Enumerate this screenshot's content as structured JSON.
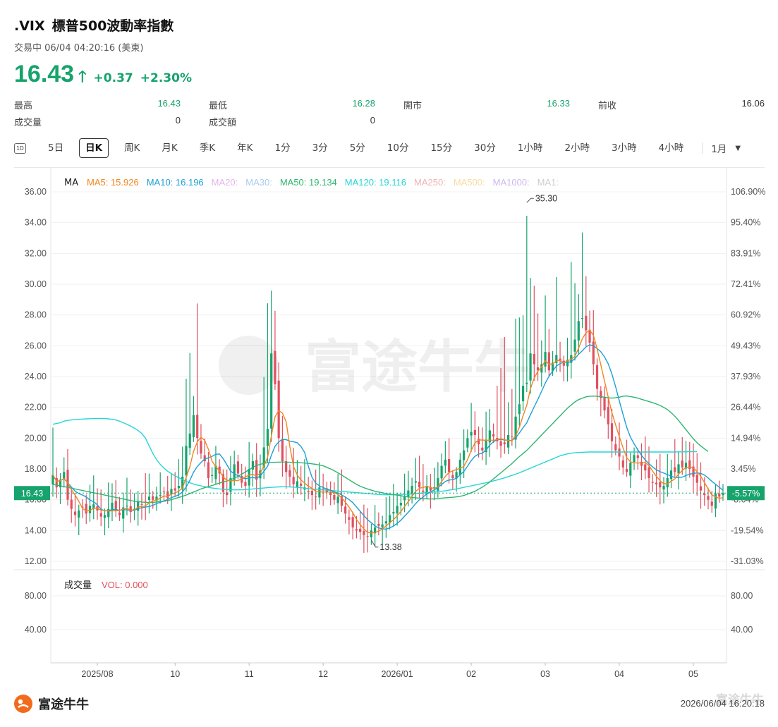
{
  "header": {
    "symbol": ".VIX",
    "name": "標普500波動率指數",
    "status": "交易中 06/04 04:20:16 (美東)",
    "price": "16.43",
    "change": "+0.37",
    "change_pct": "+2.30%"
  },
  "stats": {
    "high_label": "最高",
    "high": "16.43",
    "low_label": "最低",
    "low": "16.28",
    "open_label": "開市",
    "open": "16.33",
    "prev_label": "前收",
    "prev": "16.06",
    "volume_label": "成交量",
    "volume": "0",
    "turnover_label": "成交額",
    "turnover": "0"
  },
  "tabs": {
    "icon_label": "1D",
    "items": [
      "5日",
      "日K",
      "周K",
      "月K",
      "季K",
      "年K",
      "1分",
      "3分",
      "5分",
      "10分",
      "15分",
      "30分",
      "1小時",
      "2小時",
      "3小時",
      "4小時"
    ],
    "active": "日K",
    "dropdown_label": "1月"
  },
  "chart_data": {
    "type": "candlestick",
    "title": ".VIX 標普500波動率指數",
    "ma_label": "MA",
    "ma_legend": [
      {
        "label": "MA5: 15.926",
        "color": "#f0861f"
      },
      {
        "label": "MA10: 16.196",
        "color": "#1b9fd8"
      },
      {
        "label": "MA20:",
        "color": "#e6b3e8"
      },
      {
        "label": "MA30:",
        "color": "#a8ccec"
      },
      {
        "label": "MA50: 19.134",
        "color": "#2db56f"
      },
      {
        "label": "MA120: 19.116",
        "color": "#25d6d6"
      },
      {
        "label": "MA250:",
        "color": "#f2b3b3"
      },
      {
        "label": "MA500:",
        "color": "#f7dca0"
      },
      {
        "label": "MA1000:",
        "color": "#cdb8ee"
      },
      {
        "label": "MA1:",
        "color": "#cccccc"
      }
    ],
    "ylim": [
      12,
      36
    ],
    "y_ticks": [
      "36.00",
      "34.00",
      "32.00",
      "30.00",
      "28.00",
      "26.00",
      "24.00",
      "22.00",
      "20.00",
      "18.00",
      "16.00",
      "14.00",
      "12.00"
    ],
    "y_right_ticks": [
      "106.90%",
      "95.40%",
      "83.91%",
      "72.41%",
      "60.92%",
      "49.43%",
      "37.93%",
      "26.44%",
      "14.94%",
      "3.45%",
      "-8.04%",
      "-19.54%",
      "-31.03%"
    ],
    "x_labels": [
      {
        "label": "2025/08",
        "i": 12
      },
      {
        "label": "10",
        "i": 33
      },
      {
        "label": "11",
        "i": 53
      },
      {
        "label": "12",
        "i": 73
      },
      {
        "label": "2026/01",
        "i": 93
      },
      {
        "label": "02",
        "i": 113
      },
      {
        "label": "03",
        "i": 133
      },
      {
        "label": "04",
        "i": 153
      },
      {
        "label": "05",
        "i": 173
      }
    ],
    "current_price": "16.43",
    "current_pct": "-5.57%",
    "current_value": 16.43,
    "annotations": [
      {
        "label": "35.30",
        "i": 128,
        "value": 35.3
      },
      {
        "label": "13.38",
        "i": 86,
        "value": 13.38
      }
    ],
    "closes": [
      17.6,
      16.8,
      17.3,
      17.8,
      16.0,
      15.4,
      15.0,
      15.3,
      15.5,
      15.1,
      15.6,
      15.7,
      15.3,
      14.9,
      15.0,
      15.4,
      15.8,
      15.3,
      15.0,
      15.5,
      15.6,
      15.2,
      15.4,
      15.9,
      15.7,
      15.8,
      16.2,
      16.0,
      16.2,
      16.3,
      16.5,
      16.1,
      16.7,
      16.6,
      16.9,
      17.5,
      19.5,
      20.3,
      21.5,
      20.0,
      19.0,
      18.5,
      17.4,
      17.6,
      18.2,
      17.7,
      16.5,
      16.3,
      17.4,
      18.3,
      17.7,
      17.1,
      16.9,
      18.0,
      18.5,
      17.3,
      17.9,
      19.4,
      20.6,
      25.5,
      23.5,
      20.0,
      18.5,
      17.8,
      17.5,
      17.0,
      17.2,
      16.9,
      16.8,
      16.5,
      16.3,
      16.2,
      16.8,
      16.7,
      16.5,
      16.3,
      16.0,
      16.2,
      15.6,
      15.1,
      14.7,
      14.2,
      14.0,
      13.9,
      13.7,
      13.6,
      14.0,
      14.2,
      14.3,
      14.4,
      14.6,
      15.0,
      15.2,
      15.6,
      15.8,
      16.2,
      16.6,
      16.9,
      17.2,
      16.8,
      16.5,
      16.9,
      16.6,
      16.8,
      17.4,
      18.2,
      18.6,
      17.8,
      17.4,
      17.8,
      18.6,
      19.2,
      20.0,
      20.4,
      20.2,
      19.6,
      19.2,
      19.9,
      20.5,
      20.1,
      19.8,
      19.5,
      19.6,
      20.2,
      20.1,
      21.4,
      22.2,
      23.4,
      23.6,
      25.5,
      24.8,
      24.4,
      24.8,
      25.6,
      24.4,
      24.9,
      25.4,
      25.0,
      24.7,
      25.1,
      25.4,
      26.4,
      27.6,
      27.8,
      27.0,
      26.2,
      24.8,
      23.2,
      22.6,
      21.8,
      20.9,
      19.8,
      19.2,
      18.8,
      18.1,
      17.8,
      18.4,
      18.9,
      18.7,
      18.2,
      17.9,
      17.4,
      17.1,
      17.0,
      16.8,
      16.9,
      17.4,
      17.9,
      17.8,
      18.3,
      18.1,
      18.4,
      18.0,
      17.5,
      17.1,
      16.6,
      16.3,
      16.0,
      15.6,
      16.4,
      16.2,
      16.43
    ],
    "ma50": [
      17.0,
      16.95,
      16.9,
      16.85,
      16.8,
      16.75,
      16.7,
      16.65,
      16.6,
      16.55,
      16.5,
      16.45,
      16.4,
      16.35,
      16.3,
      16.25,
      16.2,
      16.15,
      16.1,
      16.05,
      16.0,
      15.95,
      15.9,
      15.88,
      15.85,
      15.83,
      15.82,
      15.82,
      15.85,
      15.88,
      15.9,
      15.95,
      16.0,
      16.08,
      16.15,
      16.22,
      16.3,
      16.4,
      16.5,
      16.6,
      16.7,
      16.78,
      16.85,
      16.92,
      17.0,
      17.08,
      17.15,
      17.22,
      17.3,
      17.4,
      17.52,
      17.66,
      17.8,
      17.95,
      18.1,
      18.22,
      18.3,
      18.36,
      18.4,
      18.42,
      18.43,
      18.44,
      18.45,
      18.44,
      18.43,
      18.42,
      18.41,
      18.4,
      18.38,
      18.36,
      18.33,
      18.3,
      18.25,
      18.2,
      18.1,
      18.0,
      17.88,
      17.75,
      17.6,
      17.45,
      17.3,
      17.15,
      17.0,
      16.88,
      16.78,
      16.7,
      16.62,
      16.55,
      16.5,
      16.45,
      16.4,
      16.36,
      16.33,
      16.3,
      16.26,
      16.22,
      16.18,
      16.15,
      16.12,
      16.1,
      16.08,
      16.06,
      16.05,
      16.05,
      16.07,
      16.1,
      16.12,
      16.14,
      16.16,
      16.18,
      16.22,
      16.28,
      16.36,
      16.45,
      16.55,
      16.68,
      16.82,
      16.98,
      17.15,
      17.35,
      17.55,
      17.75,
      17.95,
      18.15,
      18.35,
      18.58,
      18.8,
      19.0,
      19.2,
      19.45,
      19.7,
      19.95,
      20.2,
      20.45,
      20.7,
      20.95,
      21.2,
      21.45,
      21.7,
      21.95,
      22.15,
      22.35,
      22.5,
      22.6,
      22.68,
      22.72,
      22.73,
      22.72,
      22.7,
      22.66,
      22.62,
      22.6,
      22.62,
      22.66,
      22.72,
      22.74,
      22.7,
      22.66,
      22.6,
      22.52,
      22.45,
      22.38,
      22.3,
      22.22,
      22.12,
      22.0,
      21.85,
      21.65,
      21.42,
      21.15,
      20.85,
      20.55,
      20.25,
      19.95,
      19.7,
      19.5,
      19.3,
      19.13
    ],
    "ma120": [
      20.9,
      20.95,
      21.0,
      21.1,
      21.15,
      21.18,
      21.2,
      21.22,
      21.24,
      21.25,
      21.26,
      21.27,
      21.28,
      21.28,
      21.27,
      21.25,
      21.22,
      21.18,
      21.1,
      21.0,
      20.9,
      20.78,
      20.65,
      20.5,
      20.3,
      20.0,
      19.5,
      19.0,
      18.6,
      18.3,
      18.05,
      17.85,
      17.7,
      17.55,
      17.42,
      17.3,
      17.2,
      17.1,
      17.02,
      16.95,
      16.9,
      16.85,
      16.8,
      16.76,
      16.73,
      16.7,
      16.68,
      16.66,
      16.65,
      16.64,
      16.64,
      16.65,
      16.66,
      16.68,
      16.7,
      16.72,
      16.74,
      16.76,
      16.78,
      16.8,
      16.82,
      16.83,
      16.84,
      16.84,
      16.83,
      16.82,
      16.8,
      16.78,
      16.75,
      16.72,
      16.7,
      16.68,
      16.66,
      16.64,
      16.62,
      16.6,
      16.58,
      16.56,
      16.54,
      16.52,
      16.5,
      16.48,
      16.46,
      16.44,
      16.42,
      16.4,
      16.38,
      16.36,
      16.34,
      16.33,
      16.32,
      16.32,
      16.32,
      16.33,
      16.34,
      16.35,
      16.36,
      16.38,
      16.4,
      16.42,
      16.44,
      16.46,
      16.48,
      16.5,
      16.52,
      16.55,
      16.58,
      16.62,
      16.66,
      16.7,
      16.75,
      16.8,
      16.85,
      16.9,
      16.95,
      17.0,
      17.05,
      17.1,
      17.16,
      17.22,
      17.28,
      17.35,
      17.42,
      17.5,
      17.58,
      17.66,
      17.75,
      17.85,
      17.95,
      18.05,
      18.15,
      18.25,
      18.35,
      18.45,
      18.55,
      18.65,
      18.75,
      18.85,
      18.92,
      18.98,
      19.02,
      19.05,
      19.07,
      19.08,
      19.09,
      19.1,
      19.1,
      19.1,
      19.1,
      19.1,
      19.1,
      19.1,
      19.1,
      19.1,
      19.1,
      19.1,
      19.1,
      19.1,
      19.1,
      19.1,
      19.1,
      19.1,
      19.1,
      19.1,
      19.1,
      19.1,
      19.1,
      19.1,
      19.1,
      19.11,
      19.11,
      19.11,
      19.12,
      19.12,
      19.12
    ],
    "volume_label": "成交量",
    "volume_value": "VOL: 0.000",
    "volume_ticks": [
      "80.00",
      "40.00"
    ]
  },
  "footer": {
    "logo_text": "富途牛牛",
    "watermark_text": "富途牛牛",
    "timestamp": "2026/06/04 16:20:18"
  }
}
